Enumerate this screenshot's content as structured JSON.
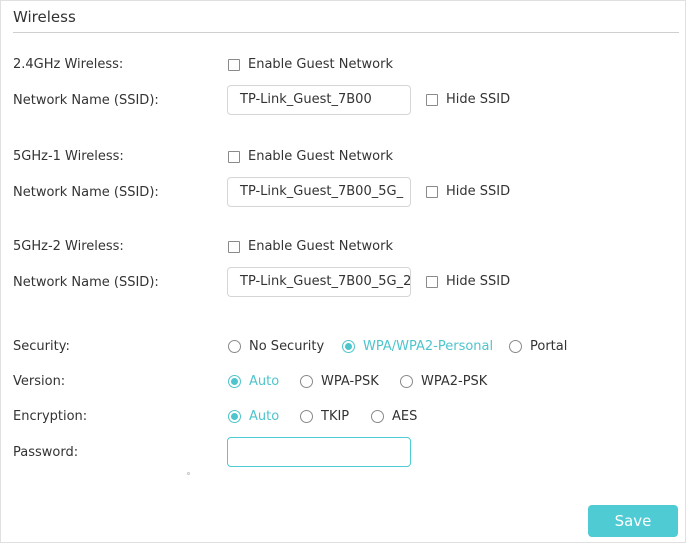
{
  "section": {
    "title": "Wireless"
  },
  "band_24": {
    "label": "2.4GHz Wireless:",
    "enable_label": "Enable Guest Network",
    "ssid_label": "Network Name (SSID):",
    "ssid_value": "TP-Link_Guest_7B00",
    "hide_label": "Hide SSID"
  },
  "band_5g1": {
    "label": "5GHz-1 Wireless:",
    "enable_label": "Enable Guest Network",
    "ssid_label": "Network Name (SSID):",
    "ssid_value": "TP-Link_Guest_7B00_5G_",
    "hide_label": "Hide SSID"
  },
  "band_5g2": {
    "label": "5GHz-2 Wireless:",
    "enable_label": "Enable Guest Network",
    "ssid_label": "Network Name (SSID):",
    "ssid_value": "TP-Link_Guest_7B00_5G_2",
    "hide_label": "Hide SSID"
  },
  "security": {
    "label": "Security:",
    "options": [
      "No Security",
      "WPA/WPA2-Personal",
      "Portal"
    ],
    "selected": "WPA/WPA2-Personal"
  },
  "version": {
    "label": "Version:",
    "options": [
      "Auto",
      "WPA-PSK",
      "WPA2-PSK"
    ],
    "selected": "Auto"
  },
  "encryption": {
    "label": "Encryption:",
    "options": [
      "Auto",
      "TKIP",
      "AES"
    ],
    "selected": "Auto"
  },
  "password": {
    "label": "Password:",
    "value": ""
  },
  "actions": {
    "save_label": "Save"
  },
  "colors": {
    "accent": "#4ecbd3",
    "selected_text": "#4ec4cc",
    "text": "#333333",
    "border": "#d5d5d5"
  }
}
